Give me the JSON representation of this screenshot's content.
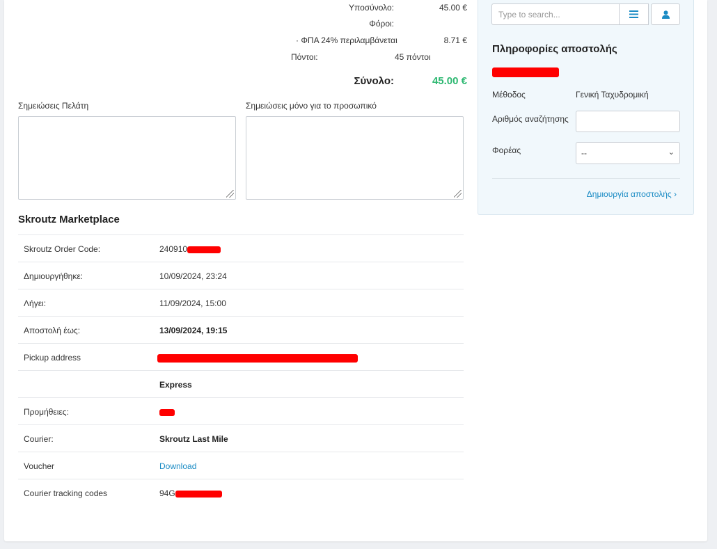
{
  "totals": {
    "subtotal_label": "Υποσύνολο:",
    "subtotal_value": "45.00 €",
    "taxes_label": "Φόροι:",
    "vat_label": "· ΦΠΑ 24% περιλαμβάνεται",
    "vat_value": "8.71 €",
    "points_label": "Πόντοι:",
    "points_value": "45 πόντοι",
    "total_label": "Σύνολο:",
    "total_value": "45.00 €"
  },
  "notes": {
    "customer_label": "Σημειώσεις Πελάτη",
    "staff_label": "Σημειώσεις μόνο για το προσωπικό"
  },
  "skroutz": {
    "title": "Skroutz Marketplace",
    "rows": [
      {
        "key": "Skroutz Order Code:",
        "value": "240910"
      },
      {
        "key": "Δημιουργήθηκε:",
        "value": "10/09/2024, 23:24"
      },
      {
        "key": "Λήγει:",
        "value": "11/09/2024, 15:00"
      },
      {
        "key": "Αποστολή έως:",
        "value": "13/09/2024, 19:15"
      },
      {
        "key": "Pickup address",
        "value": ""
      },
      {
        "key": "",
        "value": "Express"
      },
      {
        "key": "Προμήθειες:",
        "value": ""
      },
      {
        "key": "Courier:",
        "value": "Skroutz Last Mile"
      },
      {
        "key": "Voucher",
        "value": "Download"
      },
      {
        "key": "Courier tracking codes",
        "value": "94G"
      }
    ]
  },
  "sidebar": {
    "search_placeholder": "Type to search...",
    "list_icon": "list-icon",
    "user_icon": "user-icon",
    "title": "Πληροφορίες αποστολής",
    "method_label": "Μέθοδος",
    "method_value": "Γενική Ταχυδρομική",
    "tracking_label": "Αριθμός αναζήτησης",
    "carrier_label": "Φορέας",
    "carrier_selected": "--",
    "create_link": "Δημιουργία αποστολής"
  },
  "colors": {
    "accent": "#1a8bc4",
    "total_green": "#2eb872",
    "redaction": "#ff0000"
  }
}
